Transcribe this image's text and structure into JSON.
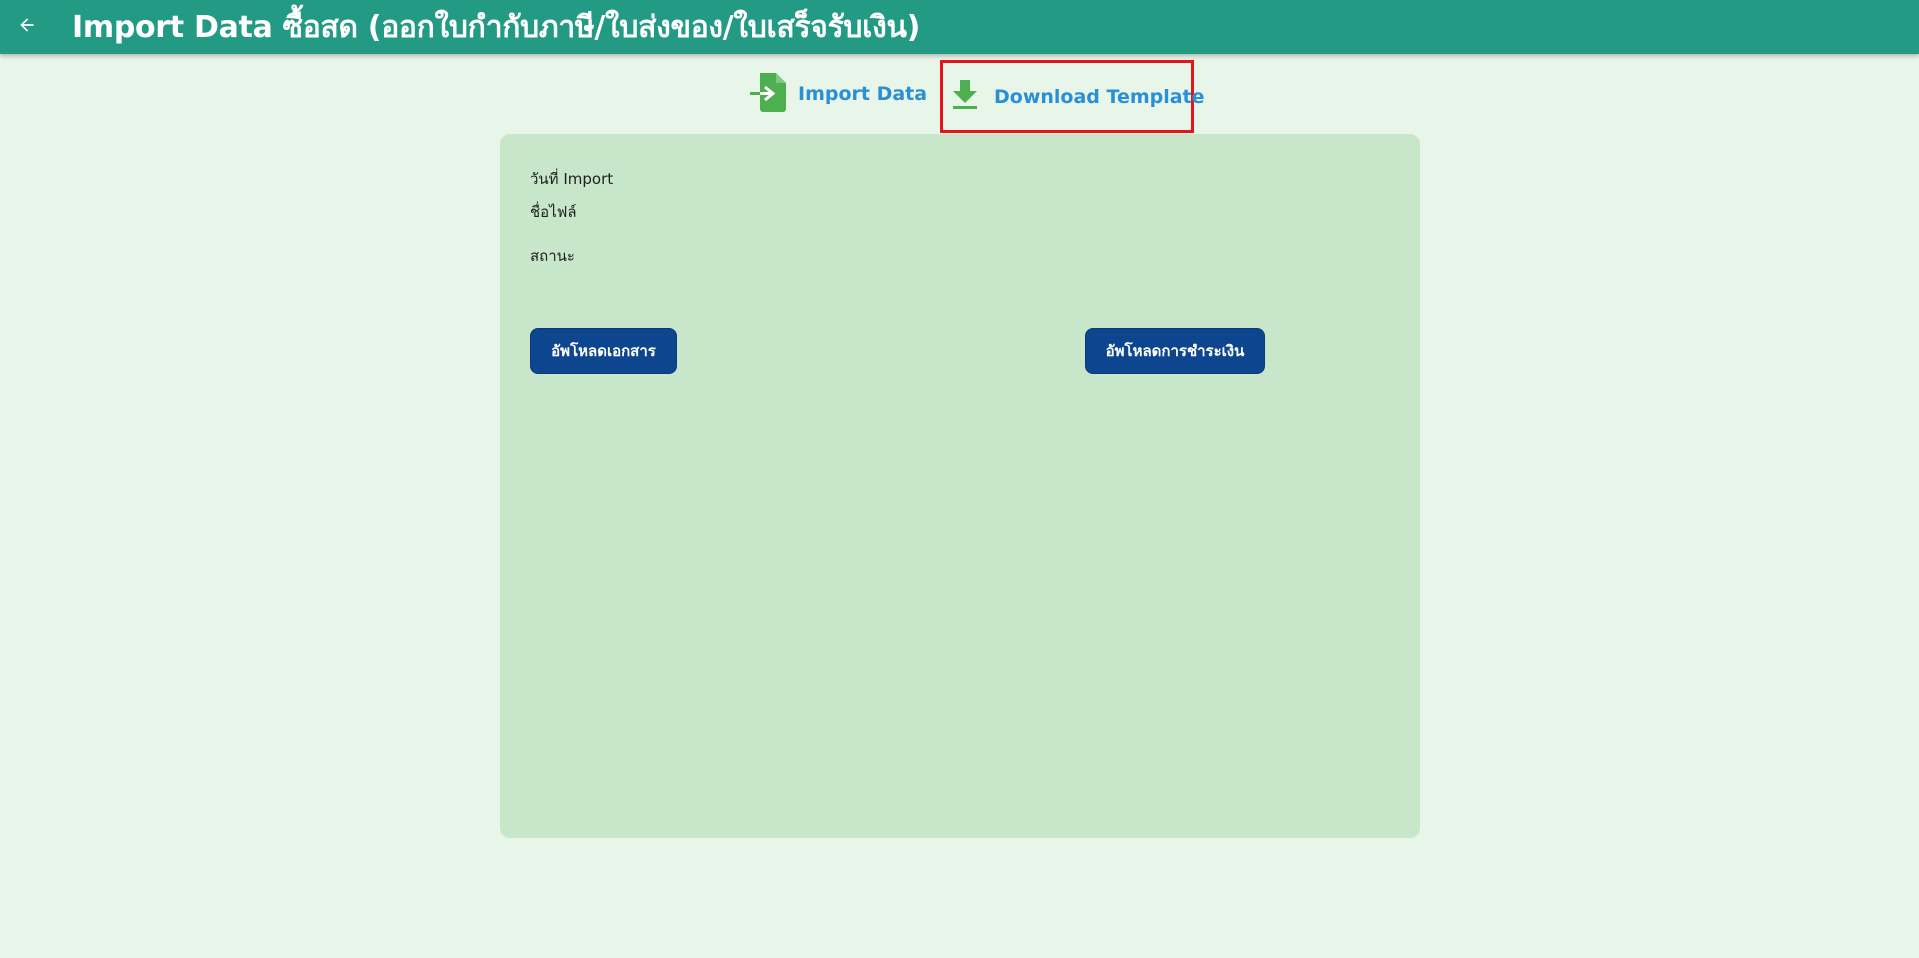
{
  "header": {
    "title": "Import Data ซื้อสด (ออกใบกำกับภาษี/ใบส่งของ/ใบเสร็จรับเงิน)",
    "back_icon": "arrow-left-icon",
    "background_color": "#229a84"
  },
  "actions": {
    "import_label": "Import Data",
    "import_icon": "file-import-icon",
    "download_label": "Download Template",
    "download_icon": "download-icon",
    "link_color": "#2b8fd6",
    "icon_color": "#4caf50",
    "highlight_color": "#e8131a"
  },
  "panel": {
    "import_date_label": "วันที่ Import",
    "file_name_label": "ชื่อไฟล์",
    "status_label": "สถานะ",
    "upload_document_button": "อัพโหลดเอกสาร",
    "upload_payment_button": "อัพโหลดการชำระเงิน",
    "button_color": "#0d468f",
    "background_color": "#c8e6c9"
  },
  "page": {
    "background_color": "#e8f5e9"
  }
}
